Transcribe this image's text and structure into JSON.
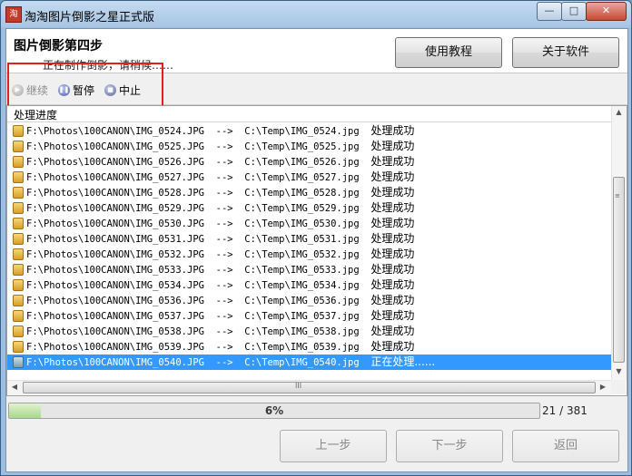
{
  "window": {
    "title": "淘淘图片倒影之星正式版",
    "app_icon_text": "淘",
    "controls": {
      "minimize": "—",
      "maximize": "□",
      "close": "✕"
    }
  },
  "header": {
    "step_title": "图片倒影第四步",
    "step_subtitle": "正在制作倒影，请稍候……",
    "tutorial_button": "使用教程",
    "about_button": "关于软件"
  },
  "toolbar": {
    "continue_label": "继续",
    "pause_label": "暂停",
    "stop_label": "中止"
  },
  "list": {
    "header": "处理进度",
    "rows": [
      {
        "src": "F:\\Photos\\100CANON\\IMG_0524.JPG",
        "arrow": "-->",
        "dst": "C:\\Temp\\IMG_0524.jpg",
        "status": "处理成功"
      },
      {
        "src": "F:\\Photos\\100CANON\\IMG_0525.JPG",
        "arrow": "-->",
        "dst": "C:\\Temp\\IMG_0525.jpg",
        "status": "处理成功"
      },
      {
        "src": "F:\\Photos\\100CANON\\IMG_0526.JPG",
        "arrow": "-->",
        "dst": "C:\\Temp\\IMG_0526.jpg",
        "status": "处理成功"
      },
      {
        "src": "F:\\Photos\\100CANON\\IMG_0527.JPG",
        "arrow": "-->",
        "dst": "C:\\Temp\\IMG_0527.jpg",
        "status": "处理成功"
      },
      {
        "src": "F:\\Photos\\100CANON\\IMG_0528.JPG",
        "arrow": "-->",
        "dst": "C:\\Temp\\IMG_0528.jpg",
        "status": "处理成功"
      },
      {
        "src": "F:\\Photos\\100CANON\\IMG_0529.JPG",
        "arrow": "-->",
        "dst": "C:\\Temp\\IMG_0529.jpg",
        "status": "处理成功"
      },
      {
        "src": "F:\\Photos\\100CANON\\IMG_0530.JPG",
        "arrow": "-->",
        "dst": "C:\\Temp\\IMG_0530.jpg",
        "status": "处理成功"
      },
      {
        "src": "F:\\Photos\\100CANON\\IMG_0531.JPG",
        "arrow": "-->",
        "dst": "C:\\Temp\\IMG_0531.jpg",
        "status": "处理成功"
      },
      {
        "src": "F:\\Photos\\100CANON\\IMG_0532.JPG",
        "arrow": "-->",
        "dst": "C:\\Temp\\IMG_0532.jpg",
        "status": "处理成功"
      },
      {
        "src": "F:\\Photos\\100CANON\\IMG_0533.JPG",
        "arrow": "-->",
        "dst": "C:\\Temp\\IMG_0533.jpg",
        "status": "处理成功"
      },
      {
        "src": "F:\\Photos\\100CANON\\IMG_0534.JPG",
        "arrow": "-->",
        "dst": "C:\\Temp\\IMG_0534.jpg",
        "status": "处理成功"
      },
      {
        "src": "F:\\Photos\\100CANON\\IMG_0536.JPG",
        "arrow": "-->",
        "dst": "C:\\Temp\\IMG_0536.jpg",
        "status": "处理成功"
      },
      {
        "src": "F:\\Photos\\100CANON\\IMG_0537.JPG",
        "arrow": "-->",
        "dst": "C:\\Temp\\IMG_0537.jpg",
        "status": "处理成功"
      },
      {
        "src": "F:\\Photos\\100CANON\\IMG_0538.JPG",
        "arrow": "-->",
        "dst": "C:\\Temp\\IMG_0538.jpg",
        "status": "处理成功"
      },
      {
        "src": "F:\\Photos\\100CANON\\IMG_0539.JPG",
        "arrow": "-->",
        "dst": "C:\\Temp\\IMG_0539.jpg",
        "status": "处理成功"
      },
      {
        "src": "F:\\Photos\\100CANON\\IMG_0540.JPG",
        "arrow": "-->",
        "dst": "C:\\Temp\\IMG_0540.jpg",
        "status": "正在处理......",
        "selected": true
      }
    ],
    "scroll_grip": "≡",
    "hscroll_grip": "III"
  },
  "progress": {
    "fraction": 0.06,
    "percent_label": "6%",
    "count_label": "21 / 381"
  },
  "footer": {
    "prev_button": "上一步",
    "next_button": "下一步",
    "back_button": "返回"
  },
  "colors": {
    "selection": "#3399ff",
    "highlight_box": "#e02020",
    "progress_fill": "#a8d98c"
  },
  "icons": {
    "row_icon": "image-file-icon",
    "continue_icon": "play-icon",
    "pause_icon": "pause-icon",
    "stop_icon": "stop-icon"
  }
}
